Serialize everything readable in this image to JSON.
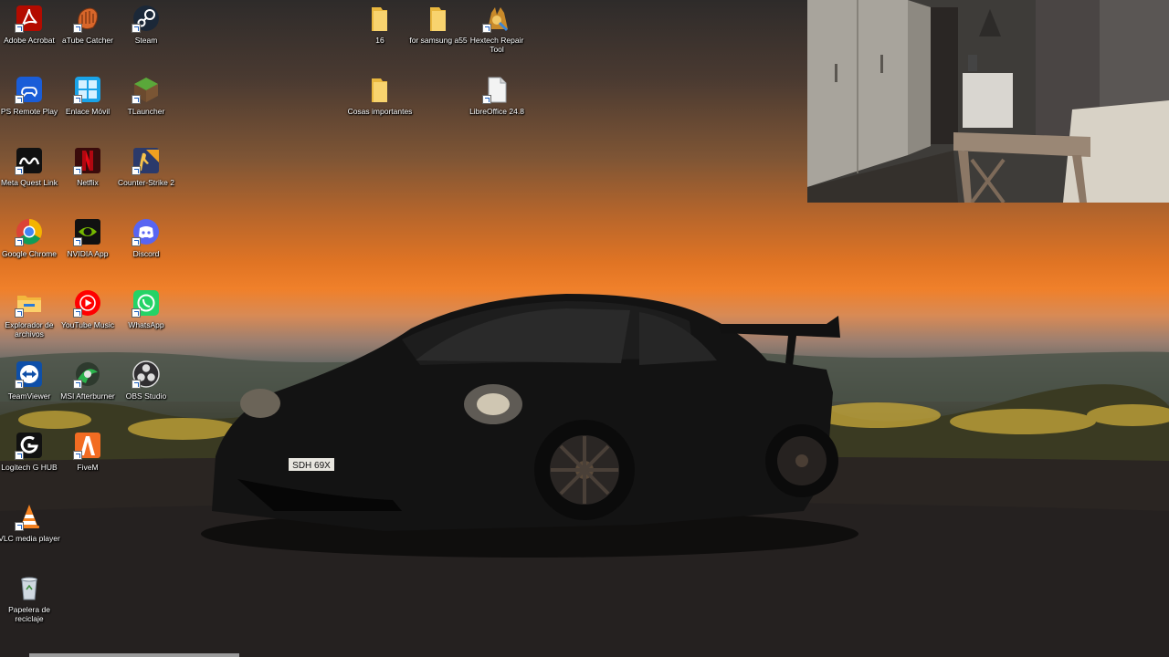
{
  "desktop": {
    "icons": [
      {
        "label": "Adobe Acrobat",
        "icon": "adobe-acrobat-icon"
      },
      {
        "label": "aTube Catcher",
        "icon": "atube-catcher-icon"
      },
      {
        "label": "Steam",
        "icon": "steam-icon"
      },
      {
        "label": "PS Remote Play",
        "icon": "ps-remote-play-icon"
      },
      {
        "label": "Enlace Móvil",
        "icon": "enlace-movil-icon"
      },
      {
        "label": "TLauncher",
        "icon": "tlauncher-icon"
      },
      {
        "label": "Meta Quest Link",
        "icon": "meta-quest-link-icon"
      },
      {
        "label": "Netflix",
        "icon": "netflix-icon"
      },
      {
        "label": "Counter-Strike 2",
        "icon": "counter-strike-icon"
      },
      {
        "label": "Google Chrome",
        "icon": "chrome-icon"
      },
      {
        "label": "NVIDIA App",
        "icon": "nvidia-icon"
      },
      {
        "label": "Discord",
        "icon": "discord-icon"
      },
      {
        "label": "Explorador de archivos",
        "icon": "file-explorer-icon"
      },
      {
        "label": "YouTube Music",
        "icon": "youtube-music-icon"
      },
      {
        "label": "WhatsApp",
        "icon": "whatsapp-icon"
      },
      {
        "label": "TeamViewer",
        "icon": "teamviewer-icon"
      },
      {
        "label": "MSI Afterburner",
        "icon": "msi-afterburner-icon"
      },
      {
        "label": "OBS Studio",
        "icon": "obs-studio-icon"
      },
      {
        "label": "Logitech G HUB",
        "icon": "logitech-ghub-icon"
      },
      {
        "label": "FiveM",
        "icon": "fivem-icon"
      },
      {
        "label": "VLC media player",
        "icon": "vlc-icon"
      },
      {
        "label": "Papelera de reciclaje",
        "icon": "recycle-bin-icon"
      },
      {
        "label": "16",
        "icon": "folder-icon"
      },
      {
        "label": "for samsung a55",
        "icon": "folder-icon"
      },
      {
        "label": "Hextech Repair Tool",
        "icon": "hextech-repair-icon"
      },
      {
        "label": "Cosas importantes",
        "icon": "folder-icon"
      },
      {
        "label": "LibreOffice 24.8",
        "icon": "libreoffice-icon"
      }
    ],
    "wallpaper": {
      "plate": "SDH 69X",
      "colors": {
        "sky": "#f0802a",
        "car": "#121212"
      }
    }
  }
}
